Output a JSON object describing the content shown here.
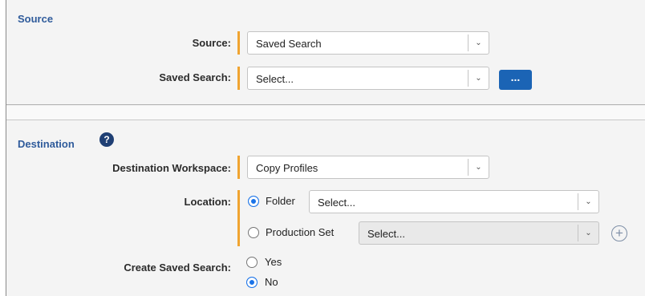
{
  "source_section": {
    "title": "Source",
    "source_label": "Source:",
    "source_value": "Saved Search",
    "saved_search_label": "Saved Search:",
    "saved_search_value": "Select...",
    "browse_button": "..."
  },
  "destination_section": {
    "title": "Destination",
    "help_icon": "?",
    "workspace_label": "Destination Workspace:",
    "workspace_value": "Copy Profiles",
    "location_label": "Location:",
    "folder_option": "Folder",
    "folder_value": "Select...",
    "folder_selected": true,
    "production_set_option": "Production Set",
    "production_set_value": "Select...",
    "production_set_selected": false,
    "create_saved_search_label": "Create Saved Search:",
    "yes_option": "Yes",
    "no_option": "No",
    "create_saved_search_value": "No"
  },
  "colors": {
    "section_title": "#2f5b9b",
    "required_bar": "#f0a431",
    "primary_button": "#1b64b5",
    "radio_checked": "#1a73e8"
  }
}
